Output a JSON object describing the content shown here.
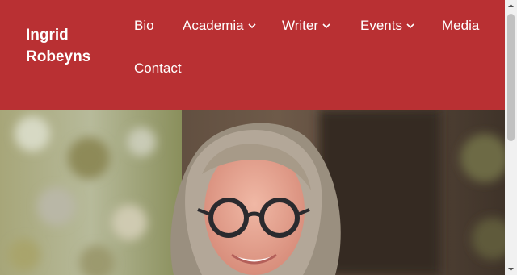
{
  "site": {
    "title": "Ingrid Robeyns"
  },
  "nav": {
    "items": [
      {
        "label": "Bio"
      },
      {
        "label": "Academia",
        "dropdown": true
      },
      {
        "label": "Writer",
        "dropdown": true
      },
      {
        "label": "Events",
        "dropdown": true
      },
      {
        "label": "Media"
      },
      {
        "label": "Contact"
      }
    ]
  },
  "colors": {
    "header_bg": "#b93033",
    "nav_text": "#ffffff"
  },
  "hero": {
    "icon": "portrait-photo"
  }
}
